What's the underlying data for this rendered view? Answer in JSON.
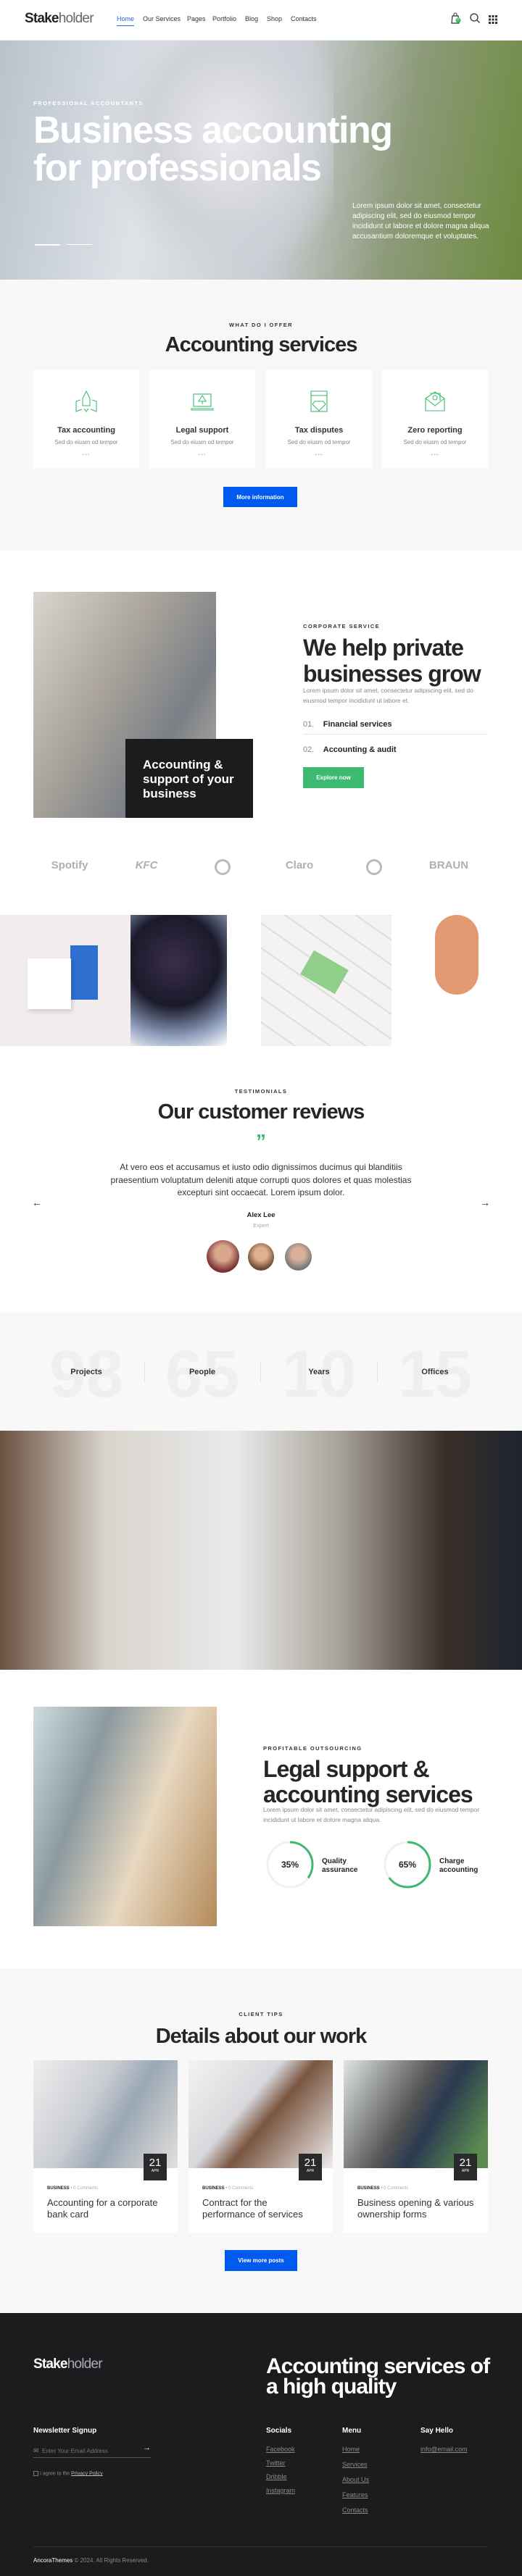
{
  "header": {
    "logo_bold": "Stake",
    "logo_light": "holder",
    "nav": [
      "Home",
      "Our Services",
      "Pages",
      "Portfolio",
      "Blog",
      "Shop",
      "Contacts"
    ],
    "cart_count": "0",
    "icons": [
      "cart-icon",
      "search-icon",
      "grid-menu-icon"
    ]
  },
  "hero": {
    "eyebrow": "PROFESSIONAL ACCOUNTANTS",
    "title_line1": "Business accounting",
    "title_line2": "for professionals",
    "text": "Lorem ipsum dolor sit amet, consectetur adipiscing elit, sed do eiusmod tempor incididunt ut labore et dolore magna aliqua accusantium doloremque et voluptates."
  },
  "services": {
    "eyebrow": "WHAT DO I OFFER",
    "title": "Accounting services",
    "button": "More information",
    "items": [
      {
        "title": "Tax accounting",
        "text": "Sed do eiusm od tempor",
        "icon": "rocket-map-icon"
      },
      {
        "title": "Legal support",
        "text": "Sed do eiusm od tempor",
        "icon": "laptop-pen-icon"
      },
      {
        "title": "Tax disputes",
        "text": "Sed do eiusm od tempor",
        "icon": "diamond-browser-icon"
      },
      {
        "title": "Zero reporting",
        "text": "Sed do eiusm od tempor",
        "icon": "envelope-icon"
      }
    ]
  },
  "corporate": {
    "box_text": "Accounting & support of your business",
    "eyebrow": "CORPORATE SERVICE",
    "title_line1": "We help private",
    "title_line2": "businesses grow",
    "text": "Lorem ipsum dolor sit amet, consectetur adipiscing elit, sed do eiusmod tempor incididunt ut labore et.",
    "items": [
      {
        "num": "01.",
        "label": "Financial services"
      },
      {
        "num": "02.",
        "label": "Accounting & audit"
      }
    ],
    "button": "Explore now"
  },
  "logos": [
    "Spotify",
    "KFC",
    "GitHub",
    "Claro",
    "CoinMarketCap",
    "BRAUN"
  ],
  "testimonials": {
    "eyebrow": "TESTIMONIALS",
    "title": "Our customer reviews",
    "quote": "At vero eos et accusamus et iusto odio dignissimos ducimus qui blanditiis praesentium voluptatum deleniti atque corrupti quos dolores et quas molestias excepturi sint occaecat. Lorem ipsum dolor.",
    "name": "Alex Lee",
    "role": "Expert"
  },
  "stats": [
    {
      "value": "98",
      "label": "Projects"
    },
    {
      "value": "65",
      "label": "People"
    },
    {
      "value": "10",
      "label": "Years"
    },
    {
      "value": "15",
      "label": "Offices"
    }
  ],
  "legal": {
    "eyebrow": "PROFITABLE OUTSOURCING",
    "title_line1": "Legal support &",
    "title_line2": "accounting services",
    "text": "Lorem ipsum dolor sit amet, consectetur adipiscing elit, sed do eiusmod tempor incididunt ut labore et dolore magna aliqua.",
    "progress": [
      {
        "value": 35,
        "display": "35%",
        "label1": "Quality",
        "label2": "assurance"
      },
      {
        "value": 65,
        "display": "65%",
        "label1": "Charge",
        "label2": "accounting"
      }
    ],
    "accent": "#3dba6f"
  },
  "blog": {
    "eyebrow": "CLIENT TIPS",
    "title": "Details about our work",
    "button": "View more posts",
    "posts": [
      {
        "day": "21",
        "month": "APR",
        "category": "BUSINESS",
        "comments": "0 Comments",
        "title": "Accounting for a corporate bank card"
      },
      {
        "day": "21",
        "month": "APR",
        "category": "BUSINESS",
        "comments": "0 Comments",
        "title": "Contract for the performance of services"
      },
      {
        "day": "21",
        "month": "APR",
        "category": "BUSINESS",
        "comments": "0 Comments",
        "title": "Business opening & various ownership forms"
      }
    ]
  },
  "footer": {
    "logo_bold": "Stake",
    "logo_light": "holder",
    "title_line1": "Accounting services of",
    "title_line2": "a high quality",
    "newsletter": "Newsletter Signup",
    "email_placeholder": "Enter Your Email Address",
    "agree": "I agree to the",
    "privacy": "Privacy Policy",
    "socials_title": "Socials",
    "socials": [
      "Facebook",
      "Twitter",
      "Dribble",
      "Instagram"
    ],
    "menu_title": "Menu",
    "menu": [
      "Home",
      "Services",
      "About Us",
      "Features",
      "Contacts"
    ],
    "hello_title": "Say Hello",
    "email": "info@email.com",
    "brand": "AncoraThemes",
    "copyright": "© 2024. All Rights Reserved."
  },
  "colors": {
    "blue": "#005af0",
    "green": "#3dba6f",
    "dark": "#1c1c1e"
  }
}
